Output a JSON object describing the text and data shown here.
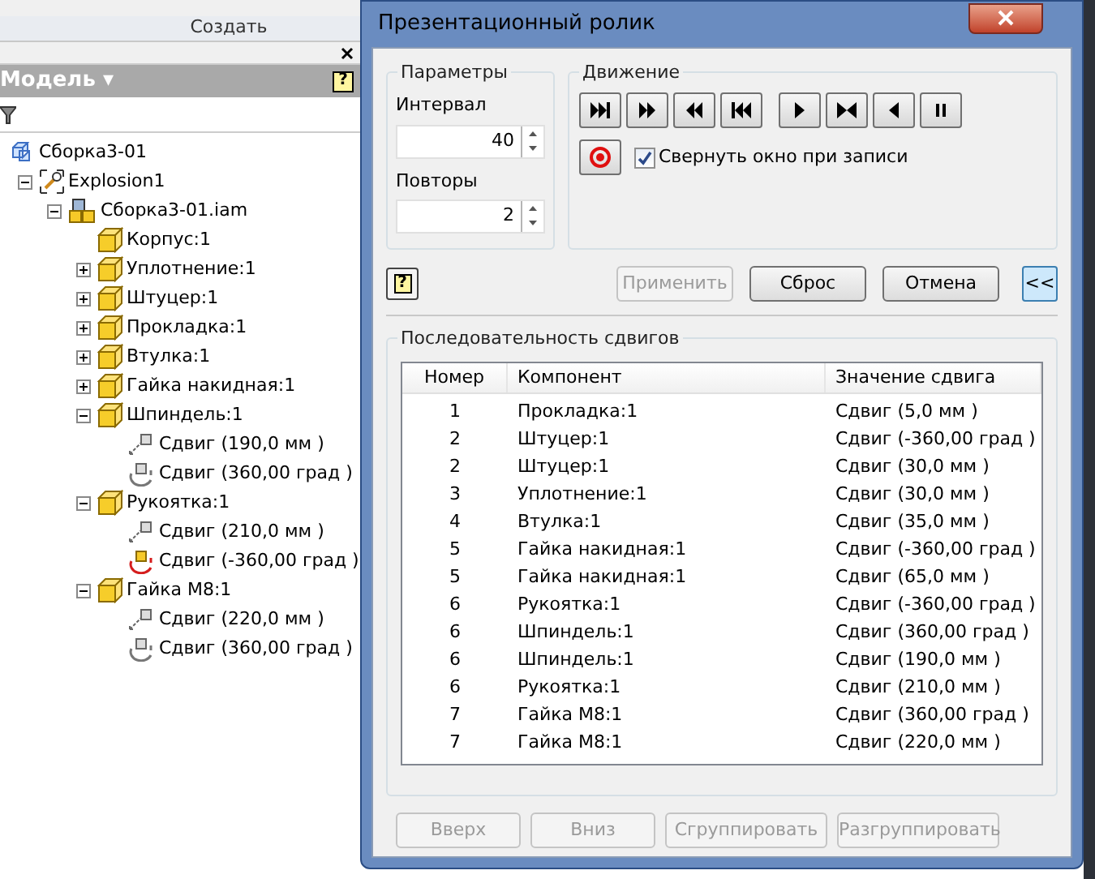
{
  "ribbon": {
    "panel_label": "Создать"
  },
  "browser": {
    "title": "Модель ▾",
    "help_mark": "?",
    "tree": [
      {
        "label": "Сборка3-01",
        "kind": "assembly-root",
        "children": [
          {
            "label": "Explosion1",
            "kind": "explosion",
            "expanded": true,
            "children": [
              {
                "label": "Сборка3-01.iam",
                "kind": "assembly",
                "expanded": true,
                "children": [
                  {
                    "label": "Корпус:1",
                    "kind": "part"
                  },
                  {
                    "label": "Уплотнение:1",
                    "kind": "part",
                    "expanded": false
                  },
                  {
                    "label": "Штуцер:1",
                    "kind": "part",
                    "expanded": false
                  },
                  {
                    "label": "Прокладка:1",
                    "kind": "part",
                    "expanded": false
                  },
                  {
                    "label": "Втулка:1",
                    "kind": "part",
                    "expanded": false
                  },
                  {
                    "label": "Гайка накидная:1",
                    "kind": "part",
                    "expanded": false
                  },
                  {
                    "label": "Шпиндель:1",
                    "kind": "part",
                    "expanded": true,
                    "children": [
                      {
                        "label": "Сдвиг (190,0 мм )",
                        "kind": "translate"
                      },
                      {
                        "label": "Сдвиг (360,00 град )",
                        "kind": "rotate"
                      }
                    ]
                  },
                  {
                    "label": "Рукоятка:1",
                    "kind": "part",
                    "expanded": true,
                    "children": [
                      {
                        "label": "Сдвиг (210,0 мм )",
                        "kind": "translate"
                      },
                      {
                        "label": "Сдвиг (-360,00 град )",
                        "kind": "rotate-flagged"
                      }
                    ]
                  },
                  {
                    "label": "Гайка M8:1",
                    "kind": "part",
                    "expanded": true,
                    "children": [
                      {
                        "label": "Сдвиг (220,0 мм )",
                        "kind": "translate"
                      },
                      {
                        "label": "Сдвиг (360,00 град )",
                        "kind": "rotate"
                      }
                    ]
                  }
                ]
              }
            ]
          }
        ]
      }
    ]
  },
  "dialog": {
    "title": "Презентационный ролик",
    "parameters": {
      "title": "Параметры",
      "interval_label": "Интервал",
      "interval": "40",
      "repeats_label": "Повторы",
      "repeats": "2"
    },
    "motion": {
      "title": "Движение",
      "buttons": [
        {
          "kind": "end-forward"
        },
        {
          "kind": "fast-forward"
        },
        {
          "kind": "fast-backward"
        },
        {
          "kind": "end-backward"
        },
        {
          "kind": "play"
        },
        {
          "kind": "middle"
        },
        {
          "kind": "play-back"
        },
        {
          "kind": "pause"
        }
      ],
      "minimize_on_record": {
        "label": "Свернуть окно при записи",
        "checked": true
      }
    },
    "actions": [
      {
        "label": "Применить",
        "disabled": true
      },
      {
        "label": "Сброс",
        "disabled": false
      },
      {
        "label": "Отмена",
        "disabled": false
      }
    ],
    "collapse_button": "<<",
    "help_mark": "?",
    "sequence": {
      "title": "Последовательность сдвигов",
      "columns": [
        "Номер",
        "Компонент",
        "Значение сдвига"
      ],
      "rows": [
        [
          "1",
          "Прокладка:1",
          "Сдвиг (5,0 мм )"
        ],
        [
          "2",
          "Штуцер:1",
          "Сдвиг (-360,00 град )"
        ],
        [
          "2",
          "Штуцер:1",
          "Сдвиг (30,0 мм )"
        ],
        [
          "3",
          "Уплотнение:1",
          "Сдвиг (30,0 мм )"
        ],
        [
          "4",
          "Втулка:1",
          "Сдвиг (35,0 мм )"
        ],
        [
          "5",
          "Гайка накидная:1",
          "Сдвиг (-360,00 град )"
        ],
        [
          "5",
          "Гайка накидная:1",
          "Сдвиг (65,0 мм )"
        ],
        [
          "6",
          "Рукоятка:1",
          "Сдвиг (-360,00 град )"
        ],
        [
          "6",
          "Шпиндель:1",
          "Сдвиг (360,00 град )"
        ],
        [
          "6",
          "Шпиндель:1",
          "Сдвиг (190,0 мм )"
        ],
        [
          "6",
          "Рукоятка:1",
          "Сдвиг (210,0 мм )"
        ],
        [
          "7",
          "Гайка M8:1",
          "Сдвиг (360,00 град )"
        ],
        [
          "7",
          "Гайка M8:1",
          "Сдвиг (220,0 мм )"
        ]
      ],
      "buttons": [
        {
          "label": "Вверх",
          "disabled": true
        },
        {
          "label": "Вниз",
          "disabled": true
        },
        {
          "label": "Сгруппировать",
          "disabled": true
        },
        {
          "label": "Разгруппировать",
          "disabled": true
        }
      ]
    }
  }
}
